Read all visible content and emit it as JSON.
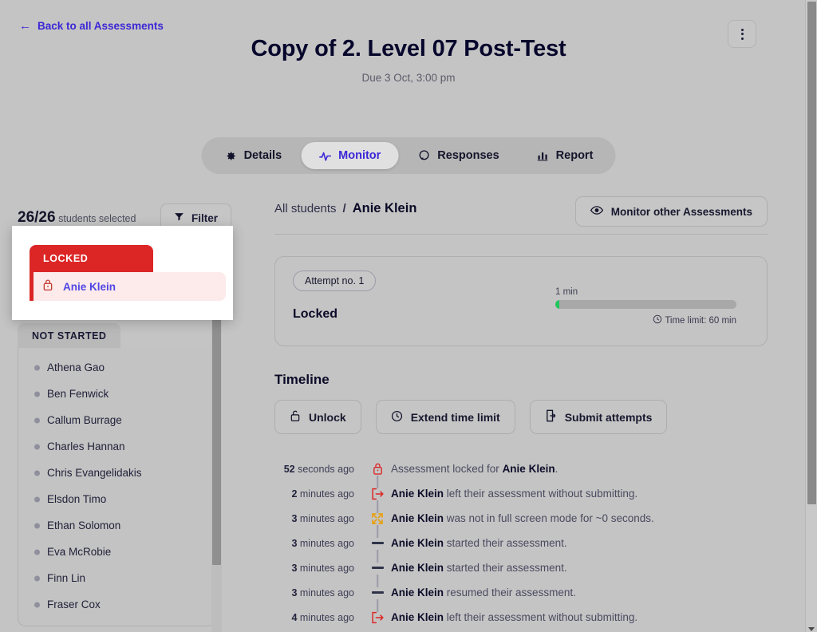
{
  "header": {
    "back_label": "Back to all Assessments",
    "back_icon": "arrow-left-icon",
    "kebab_icon": "more-vertical-icon",
    "title": "Copy of 2. Level 07 Post-Test",
    "subtitle": "Due 3 Oct, 3:00 pm"
  },
  "tabs": [
    {
      "label": "Details",
      "icon": "gear-icon",
      "active": false
    },
    {
      "label": "Monitor",
      "icon": "pulse-icon",
      "active": true
    },
    {
      "label": "Responses",
      "icon": "comment-icon",
      "active": false
    },
    {
      "label": "Report",
      "icon": "bar-chart-icon",
      "active": false
    }
  ],
  "sidebar": {
    "selected_count": "26/26",
    "selected_suffix": "students selected",
    "filter_label": "Filter",
    "filter_icon": "funnel-icon",
    "locked_popup": {
      "group_label": "LOCKED",
      "student_name": "Anie Klein",
      "lock_icon": "lock-icon"
    },
    "not_started": {
      "group_label": "NOT STARTED",
      "students": [
        "Athena Gao",
        "Ben Fenwick",
        "Callum Burrage",
        "Charles Hannan",
        "Chris Evangelidakis",
        "Elsdon Timo",
        "Ethan Solomon",
        "Eva McRobie",
        "Finn Lin",
        "Fraser Cox"
      ]
    }
  },
  "main": {
    "breadcrumb_all": "All students",
    "breadcrumb_sep": "/",
    "breadcrumb_current": "Anie Klein",
    "monitor_other_label": "Monitor other Assessments",
    "monitor_other_icon": "eye-icon",
    "attempt": {
      "pill_label": "Attempt no. 1",
      "status": "Locked",
      "elapsed_label": "1 min",
      "time_limit_label": "Time limit: 60 min",
      "clock_icon": "clock-icon",
      "progress_percent": 2,
      "progress_color": "#22c55e"
    },
    "timeline_heading": "Timeline",
    "actions": [
      {
        "label": "Unlock",
        "icon": "unlock-icon"
      },
      {
        "label": "Extend time limit",
        "icon": "clock-icon"
      },
      {
        "label": "Submit attempts",
        "icon": "submit-doc-icon"
      }
    ],
    "timeline_events": [
      {
        "time_num": "52",
        "time_unit": "seconds ago",
        "icon": "lock-icon",
        "icon_color": "#dc2626",
        "lead": "",
        "text": "Assessment locked for ",
        "bold_tail": "Anie Klein",
        "tail": "."
      },
      {
        "time_num": "2",
        "time_unit": "minutes ago",
        "icon": "logout-icon",
        "icon_color": "#dc2626",
        "lead": "Anie Klein",
        "text": " left their assessment without submitting.",
        "bold_tail": "",
        "tail": ""
      },
      {
        "time_num": "3",
        "time_unit": "minutes ago",
        "icon": "fullscreen-icon",
        "icon_color": "#e6a117",
        "lead": "Anie Klein",
        "text": " was not in full screen mode for ~0 seconds.",
        "bold_tail": "",
        "tail": ""
      },
      {
        "time_num": "3",
        "time_unit": "minutes ago",
        "icon": "dash-icon",
        "icon_color": "#2f3349",
        "lead": "Anie Klein",
        "text": " started their assessment.",
        "bold_tail": "",
        "tail": ""
      },
      {
        "time_num": "3",
        "time_unit": "minutes ago",
        "icon": "dash-icon",
        "icon_color": "#2f3349",
        "lead": "Anie Klein",
        "text": " started their assessment.",
        "bold_tail": "",
        "tail": ""
      },
      {
        "time_num": "3",
        "time_unit": "minutes ago",
        "icon": "dash-icon",
        "icon_color": "#2f3349",
        "lead": "Anie Klein",
        "text": " resumed their assessment.",
        "bold_tail": "",
        "tail": ""
      },
      {
        "time_num": "4",
        "time_unit": "minutes ago",
        "icon": "logout-icon",
        "icon_color": "#dc2626",
        "lead": "Anie Klein",
        "text": " left their assessment without submitting.",
        "bold_tail": "",
        "tail": ""
      }
    ]
  },
  "colors": {
    "accent": "#3b27d6",
    "locked_red": "#dc2626",
    "locked_row_bg": "#fdeaea",
    "page_bg": "#c4c4c4",
    "warning_orange": "#e6a117"
  }
}
